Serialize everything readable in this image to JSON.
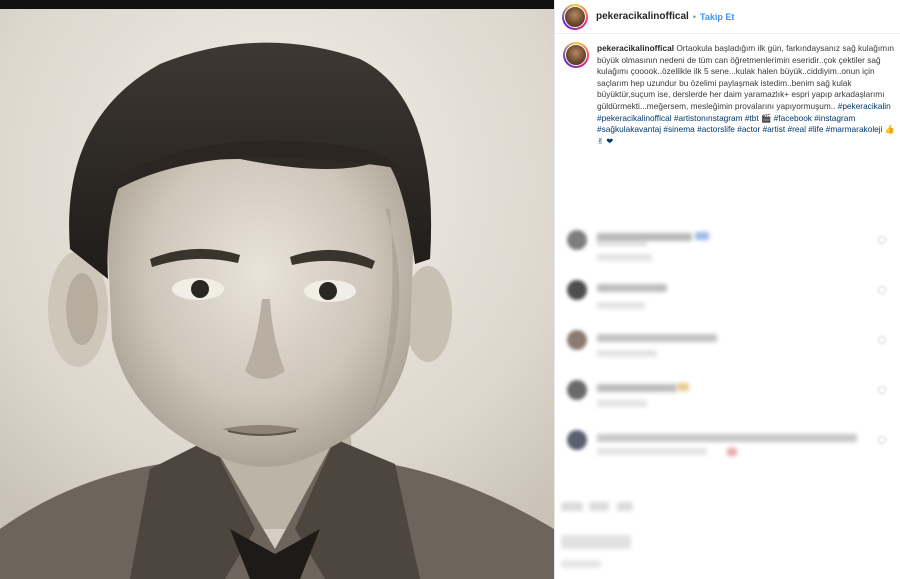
{
  "post": {
    "username": "pekeracikalinoffical",
    "separator": "•",
    "follow_label": "Takip Et"
  },
  "caption": {
    "username": "pekeracikalinoffical",
    "text": "Ortaokula başladığım ilk gün, farkındaysanız sağ kulağımın büyük olmasının nedeni de tüm can öğretmenlerimin eseridir..çok çektiler sağ kulağımı çooook..özellikle ilk 5 sene...kulak halen büyük..ciddiyim..onun için saçlarım hep uzundur bu özelimi paylaşmak istedim..benim sağ kulak büyüktür,suçum ise, derslerde her daim yaramazlık+ espri yapıp arkadaşlarımı güldürmekti...meğersem, mesleğimin provalarını yapıyormuşum..",
    "hashtags": "#pekeracikalin #pekeracikalinoffical #artistonınstagram #tbt 🎬 #facebook #instagram #sağkulakavantaj #sinema #actorslife #actor #artist #real #life #marmarakoleji 👍 ✌ ❤"
  },
  "icons": {
    "avatar": "profile-avatar-icon",
    "comment_avatar": "blurred-avatar-icon",
    "like": "heart-icon"
  },
  "colors": {
    "link": "#3897f0",
    "hashtag": "#00376b",
    "heart": "#ed4956"
  }
}
